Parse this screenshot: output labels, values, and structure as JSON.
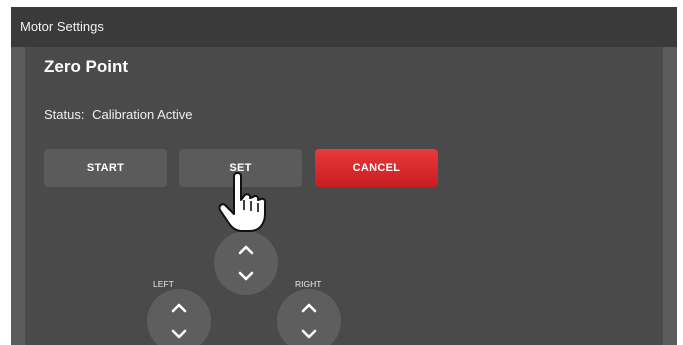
{
  "window": {
    "title": "Motor Settings"
  },
  "section": {
    "title": "Zero Point"
  },
  "status": {
    "label": "Status:",
    "value": "Calibration Active"
  },
  "buttons": {
    "start": "START",
    "set": "SET",
    "cancel": "CANCEL"
  },
  "jog": {
    "left_label": "LEFT",
    "right_label": "RIGHT"
  },
  "colors": {
    "cancel_accent": "#d92a2e",
    "panel_bg": "#4a4a4a",
    "titlebar_bg": "#3a3a3a"
  },
  "icons": {
    "up": "chevron-up-icon",
    "down": "chevron-down-icon",
    "cursor": "pointing-hand-cursor-icon"
  }
}
